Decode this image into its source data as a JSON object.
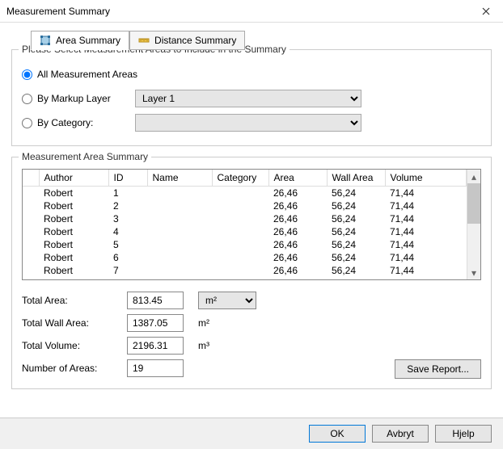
{
  "window": {
    "title": "Measurement Summary"
  },
  "tabs": {
    "area": "Area Summary",
    "distance": "Distance Summary"
  },
  "select_group": {
    "legend": "Please Select Measurement Areas to Include in the Summary",
    "opt_all": "All Measurement Areas",
    "opt_layer": "By Markup Layer",
    "opt_category": "By Category:",
    "layer_value": "Layer 1",
    "category_value": ""
  },
  "summary_group": {
    "legend": "Measurement Area Summary",
    "columns": {
      "author": "Author",
      "id": "ID",
      "name": "Name",
      "category": "Category",
      "area": "Area",
      "wall": "Wall Area",
      "volume": "Volume"
    },
    "rows": [
      {
        "author": "Robert",
        "id": "1",
        "name": "",
        "category": "",
        "area": "26,46",
        "wall": "56,24",
        "volume": "71,44"
      },
      {
        "author": "Robert",
        "id": "2",
        "name": "",
        "category": "",
        "area": "26,46",
        "wall": "56,24",
        "volume": "71,44"
      },
      {
        "author": "Robert",
        "id": "3",
        "name": "",
        "category": "",
        "area": "26,46",
        "wall": "56,24",
        "volume": "71,44"
      },
      {
        "author": "Robert",
        "id": "4",
        "name": "",
        "category": "",
        "area": "26,46",
        "wall": "56,24",
        "volume": "71,44"
      },
      {
        "author": "Robert",
        "id": "5",
        "name": "",
        "category": "",
        "area": "26,46",
        "wall": "56,24",
        "volume": "71,44"
      },
      {
        "author": "Robert",
        "id": "6",
        "name": "",
        "category": "",
        "area": "26,46",
        "wall": "56,24",
        "volume": "71,44"
      },
      {
        "author": "Robert",
        "id": "7",
        "name": "",
        "category": "",
        "area": "26,46",
        "wall": "56,24",
        "volume": "71,44"
      }
    ]
  },
  "totals": {
    "area_label": "Total Area:",
    "area_value": "813.45",
    "area_unit": "m²",
    "wall_label": "Total Wall Area:",
    "wall_value": "1387.05",
    "wall_unit": "m²",
    "vol_label": "Total Volume:",
    "vol_value": "2196.31",
    "vol_unit": "m³",
    "count_label": "Number of Areas:",
    "count_value": "19"
  },
  "buttons": {
    "save": "Save Report...",
    "ok": "OK",
    "cancel": "Avbryt",
    "help": "Hjelp"
  }
}
